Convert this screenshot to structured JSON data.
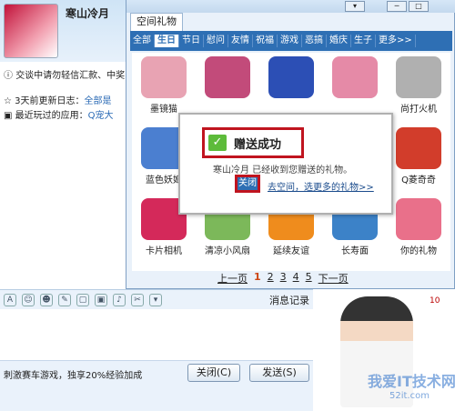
{
  "chat": {
    "friend_name": "寒山冷月",
    "notice": "交谈中请勿轻信汇款、中奖",
    "update_label": "3天前更新日志：",
    "update_link": "全部是",
    "apps_label": "最近玩过的应用：",
    "apps_link": "Q宠大"
  },
  "gift_window": {
    "tab_title": "空间礼物",
    "window_buttons": [
      "▾",
      "─",
      "□"
    ],
    "categories": [
      "全部",
      "生日",
      "节日",
      "慰问",
      "友情",
      "祝福",
      "游戏",
      "恶搞",
      "婚庆",
      "生子",
      "更多>>"
    ],
    "selected_category": "生日",
    "gifts": [
      {
        "label": "墨镜猫",
        "color": "#e8a3b3"
      },
      {
        "label": "",
        "color": "#c24b7a"
      },
      {
        "label": "",
        "color": "#2c4fb5"
      },
      {
        "label": "",
        "color": "#e58aa7"
      },
      {
        "label": "尚打火机",
        "color": "#b0b0b0"
      },
      {
        "label": "蓝色妖姬",
        "color": "#4b7fd0"
      },
      {
        "label": "",
        "color": "#ffffff"
      },
      {
        "label": "",
        "color": "#ffffff"
      },
      {
        "label": "",
        "color": "#ffffff"
      },
      {
        "label": "Q菱奇奇",
        "color": "#d23d2b"
      },
      {
        "label": "卡片相机",
        "color": "#d4295a"
      },
      {
        "label": "清凉小风扇",
        "color": "#7cb85a"
      },
      {
        "label": "延续友谊",
        "color": "#ef8c1d"
      },
      {
        "label": "长寿面",
        "color": "#3c82c8"
      },
      {
        "label": "你的礼物",
        "color": "#e9708a"
      }
    ],
    "pager": {
      "prev": "上一页",
      "pages": [
        "1",
        "2",
        "3",
        "4",
        "5"
      ],
      "current": "1",
      "next": "下一页"
    }
  },
  "dialog": {
    "title": "赠送成功",
    "message": "寒山冷月 已经收到您赠送的礼物。",
    "close_label": "关闭",
    "more_link": "去空间，选更多的礼物>>"
  },
  "input_area": {
    "history_label": "消息记录",
    "toolbar_icons": [
      "font-icon",
      "emoji-icon",
      "wink-icon",
      "doodle-icon",
      "screenshot-icon",
      "image-icon",
      "music-icon",
      "scissors-icon",
      "more-icon"
    ]
  },
  "footer": {
    "promo": "刺激赛车游戏，独享20%经验加成",
    "close_label": "关闭(C)",
    "send_label": "发送(S)"
  },
  "right_panel": {
    "watermark": "我爱IT技术网",
    "watermark_sub": "52it.com",
    "level": "10"
  }
}
